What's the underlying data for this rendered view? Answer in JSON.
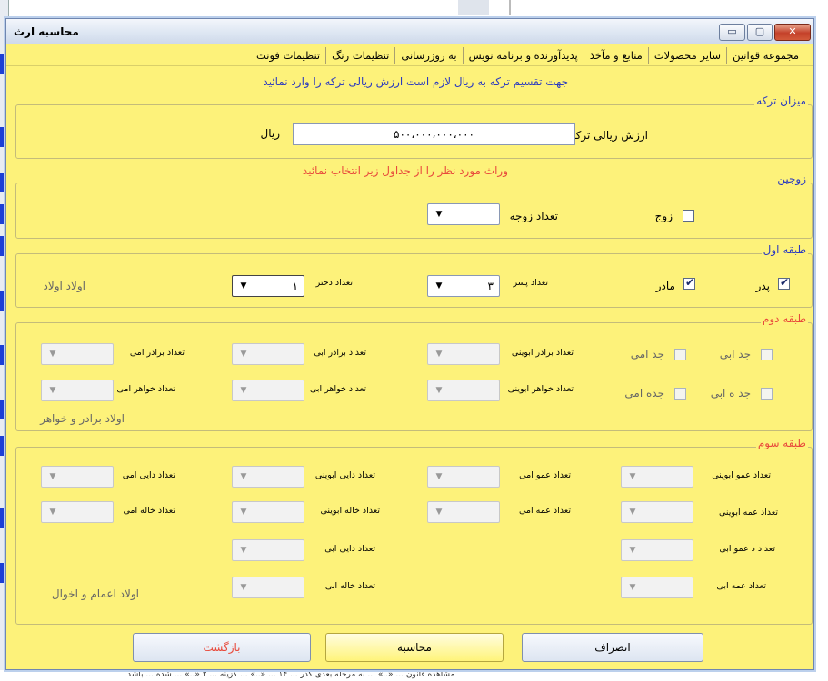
{
  "window": {
    "title": "محاسبه ارث",
    "minimize": "▭",
    "maximize": "▢",
    "close": "✕"
  },
  "tabs": [
    "مجموعه قوانین",
    "سایر محصولات",
    "منابع و مآخذ",
    "پدیدآورنده و برنامه نویس",
    "به روزرسانی",
    "تنظیمات رنگ",
    "تنظیمات فونت"
  ],
  "notice_top": "جهت تقسیم ترکه به ریال لازم است ارزش ریالی ترکه را وارد نمائید",
  "notice_mid": "وراث مورد نظر را از جداول زیر انتخاب نمائید",
  "estate": {
    "title": "میزان ترکه",
    "label": "ارزش ریالی ترکه",
    "value": "۵۰۰،۰۰۰،۰۰۰،۰۰۰",
    "unit": "ریال"
  },
  "spouse": {
    "title": "زوجین",
    "husband": "زوج",
    "wives_label": "تعداد زوجه",
    "wives_value": ""
  },
  "first": {
    "title": "طبقه اول",
    "father": "پدر",
    "mother": "مادر",
    "sons_label": "تعداد پسر",
    "sons_value": "۳",
    "daughters_label": "تعداد دختر",
    "daughters_value": "۱",
    "descendants": "اولاد اولاد"
  },
  "second": {
    "title": "طبقه دوم",
    "pgf": "جد ابی",
    "mgf": "جد امی",
    "pgm": "جد ه ابی",
    "mgm": "جده امی",
    "full_brothers": "تعداد برادر ابوینی",
    "pat_brothers": "تعداد برادر ابی",
    "mat_brothers": "تعداد برادر امی",
    "full_sisters": "تعداد خواهر ابوینی",
    "pat_sisters": "تعداد خواهر ابی",
    "mat_sisters": "تعداد خواهر امی",
    "descendants": "اولاد برادر و خواهر"
  },
  "third": {
    "title": "طبقه سوم",
    "uncle_full": "تعداد عمو ابوینی",
    "uncle_mat": "تعداد عمو امی",
    "mat_uncle_full": "تعداد دایی ابوینی",
    "mat_uncle_mat": "تعداد دایی امی",
    "aunt_full": "تعداد عمه ابوینی",
    "aunt_mat": "تعداد عمه امی",
    "mat_aunt_full": "تعداد خاله ابوینی",
    "mat_aunt_mat": "تعداد خاله امی",
    "uncle_pat": "تعداد د عمو ابی",
    "mat_uncle_pat": "تعداد دایی ابی",
    "aunt_pat": "تعداد عمه ابی",
    "mat_aunt_pat": "تعداد خاله ابی",
    "descendants": "اولاد اعمام و اخوال"
  },
  "buttons": {
    "cancel": "انصراف",
    "calculate": "محاسبه",
    "back": "بازگشت"
  },
  "background": {
    "bottom_text": "مشاهده قانون ... «..» ... به مرحله بعدی گذر ... ۱۴ ... «..» ... گزینه ... ۲ «..» ... شده ... باشد"
  },
  "icons": {
    "dropdown": "▼"
  }
}
